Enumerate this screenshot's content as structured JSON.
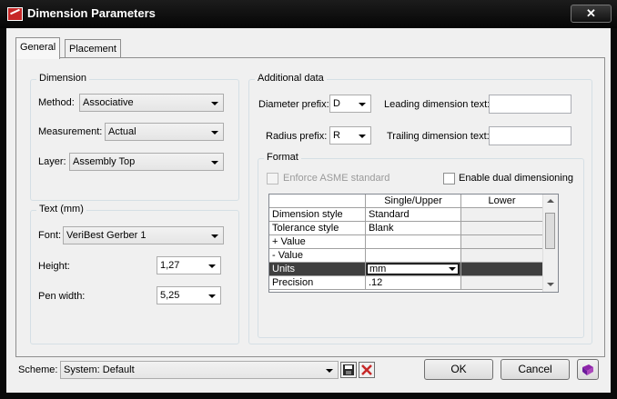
{
  "window": {
    "title": "Dimension Parameters",
    "close_symbol": "✕"
  },
  "tabs": [
    {
      "label": "General"
    },
    {
      "label": "Placement"
    }
  ],
  "dimension": {
    "title": "Dimension",
    "method": {
      "label": "Method:",
      "value": "Associative"
    },
    "measurement": {
      "label": "Measurement:",
      "value": "Actual"
    },
    "layer": {
      "label": "Layer:",
      "value": "Assembly Top"
    }
  },
  "text_group": {
    "title": "Text (mm)",
    "font": {
      "label": "Font:",
      "value": "VeriBest Gerber 1"
    },
    "height": {
      "label": "Height:",
      "value": "1,27"
    },
    "pen_width": {
      "label": "Pen width:",
      "value": "5,25"
    }
  },
  "additional": {
    "title": "Additional data",
    "diameter_prefix": {
      "label": "Diameter prefix:",
      "value": "D"
    },
    "radius_prefix": {
      "label": "Radius prefix:",
      "value": "R"
    },
    "leading_text": {
      "label": "Leading dimension text:",
      "value": ""
    },
    "trailing_text": {
      "label": "Trailing dimension text:",
      "value": ""
    }
  },
  "format": {
    "title": "Format",
    "enforce_asme": {
      "label": "Enforce ASME standard",
      "checked": false,
      "enabled": false
    },
    "dual_dim": {
      "label": "Enable dual dimensioning",
      "checked": false
    },
    "table": {
      "columns": [
        "",
        "Single/Upper",
        "Lower"
      ],
      "rows": [
        {
          "name": "Dimension style",
          "upper": "Standard",
          "lower": ""
        },
        {
          "name": "Tolerance style",
          "upper": "Blank",
          "lower": ""
        },
        {
          "name": "+ Value",
          "upper": "",
          "lower": ""
        },
        {
          "name": "- Value",
          "upper": "",
          "lower": ""
        },
        {
          "name": "Units",
          "upper": "mm",
          "lower": ""
        },
        {
          "name": "Precision",
          "upper": ".12",
          "lower": ""
        }
      ]
    }
  },
  "scheme": {
    "label": "Scheme:",
    "value": "System: Default"
  },
  "buttons": {
    "ok": "OK",
    "cancel": "Cancel"
  },
  "colors": {
    "selected_row": "#3f3f3f",
    "title_bar": "#0a0a0a"
  }
}
